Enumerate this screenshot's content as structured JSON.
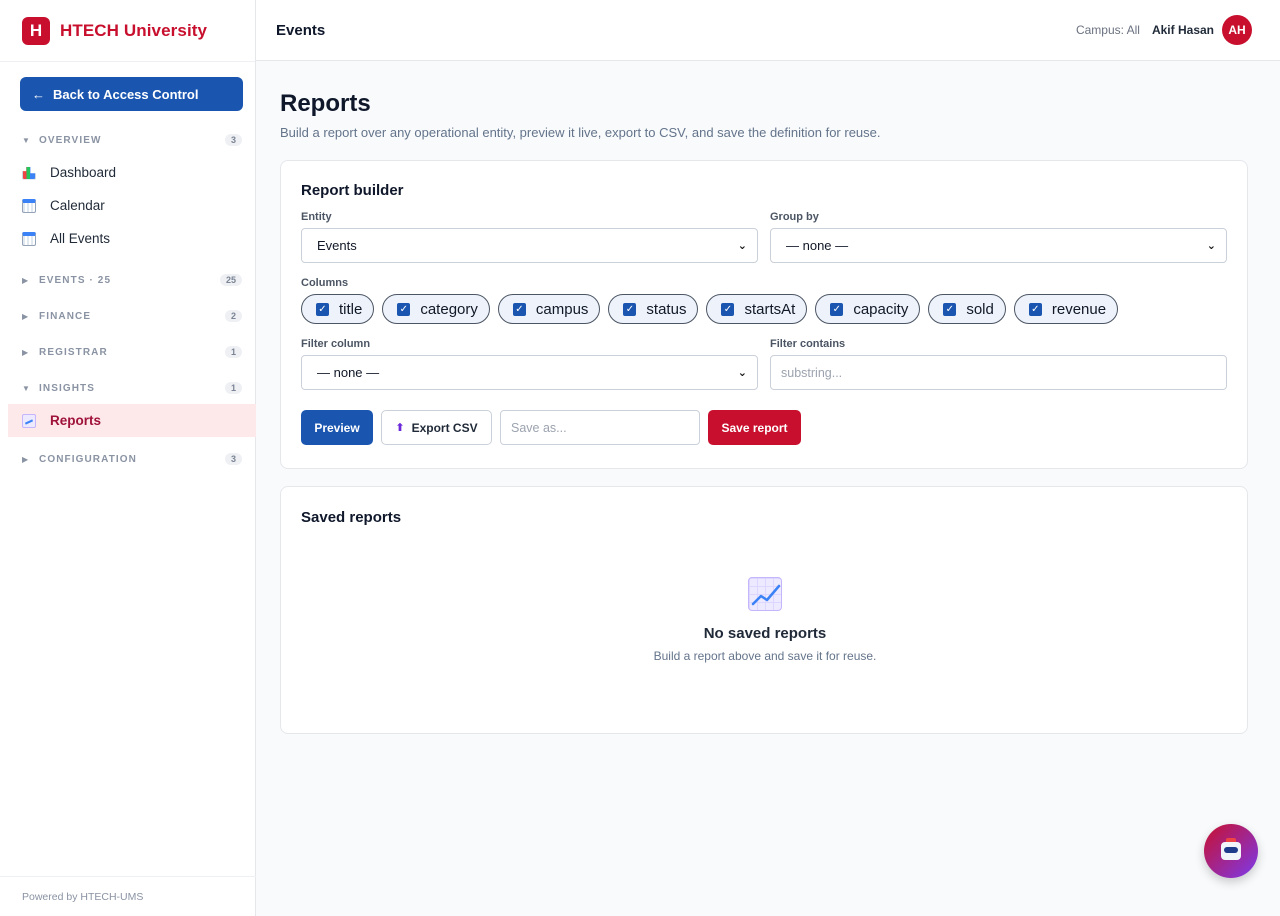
{
  "brand": {
    "logo_letter": "H",
    "name": "HTECH University",
    "color": "#c8102e"
  },
  "sidebar": {
    "back_label": "Back to Access Control",
    "sections": [
      {
        "label": "OVERVIEW",
        "count": "3",
        "expanded": true,
        "items": [
          {
            "label": "Dashboard",
            "icon": "bar-chart-icon"
          },
          {
            "label": "Calendar",
            "icon": "calendar-icon"
          },
          {
            "label": "All Events",
            "icon": "calendar-icon"
          }
        ]
      },
      {
        "label": "EVENTS · 25",
        "count": "25",
        "expanded": false
      },
      {
        "label": "FINANCE",
        "count": "2",
        "expanded": false
      },
      {
        "label": "REGISTRAR",
        "count": "1",
        "expanded": false
      },
      {
        "label": "INSIGHTS",
        "count": "1",
        "expanded": true,
        "items": [
          {
            "label": "Reports",
            "icon": "line-chart-icon",
            "active": true
          }
        ]
      },
      {
        "label": "CONFIGURATION",
        "count": "3",
        "expanded": false
      }
    ],
    "footer": "Powered by HTECH-UMS"
  },
  "header": {
    "title": "Events",
    "campus": "Campus: All",
    "user_name": "Akif Hasan",
    "avatar_initials": "AH"
  },
  "page": {
    "title": "Reports",
    "subtitle": "Build a report over any operational entity, preview it live, export to CSV, and save the definition for reuse."
  },
  "builder": {
    "title": "Report builder",
    "entity_label": "Entity",
    "entity_value": "Events",
    "group_label": "Group by",
    "group_value": "— none —",
    "columns_label": "Columns",
    "columns": [
      "title",
      "category",
      "campus",
      "status",
      "startsAt",
      "capacity",
      "sold",
      "revenue"
    ],
    "filter_col_label": "Filter column",
    "filter_col_value": "— none —",
    "filter_contains_label": "Filter contains",
    "filter_contains_placeholder": "substring...",
    "preview_label": "Preview",
    "export_label": "Export CSV",
    "save_as_placeholder": "Save as...",
    "save_label": "Save report"
  },
  "saved": {
    "title": "Saved reports",
    "empty_title": "No saved reports",
    "empty_sub": "Build a report above and save it for reuse."
  },
  "colors": {
    "primary": "#1a56b0",
    "accent_red": "#c8102e",
    "active_bg": "#fde8ea"
  }
}
